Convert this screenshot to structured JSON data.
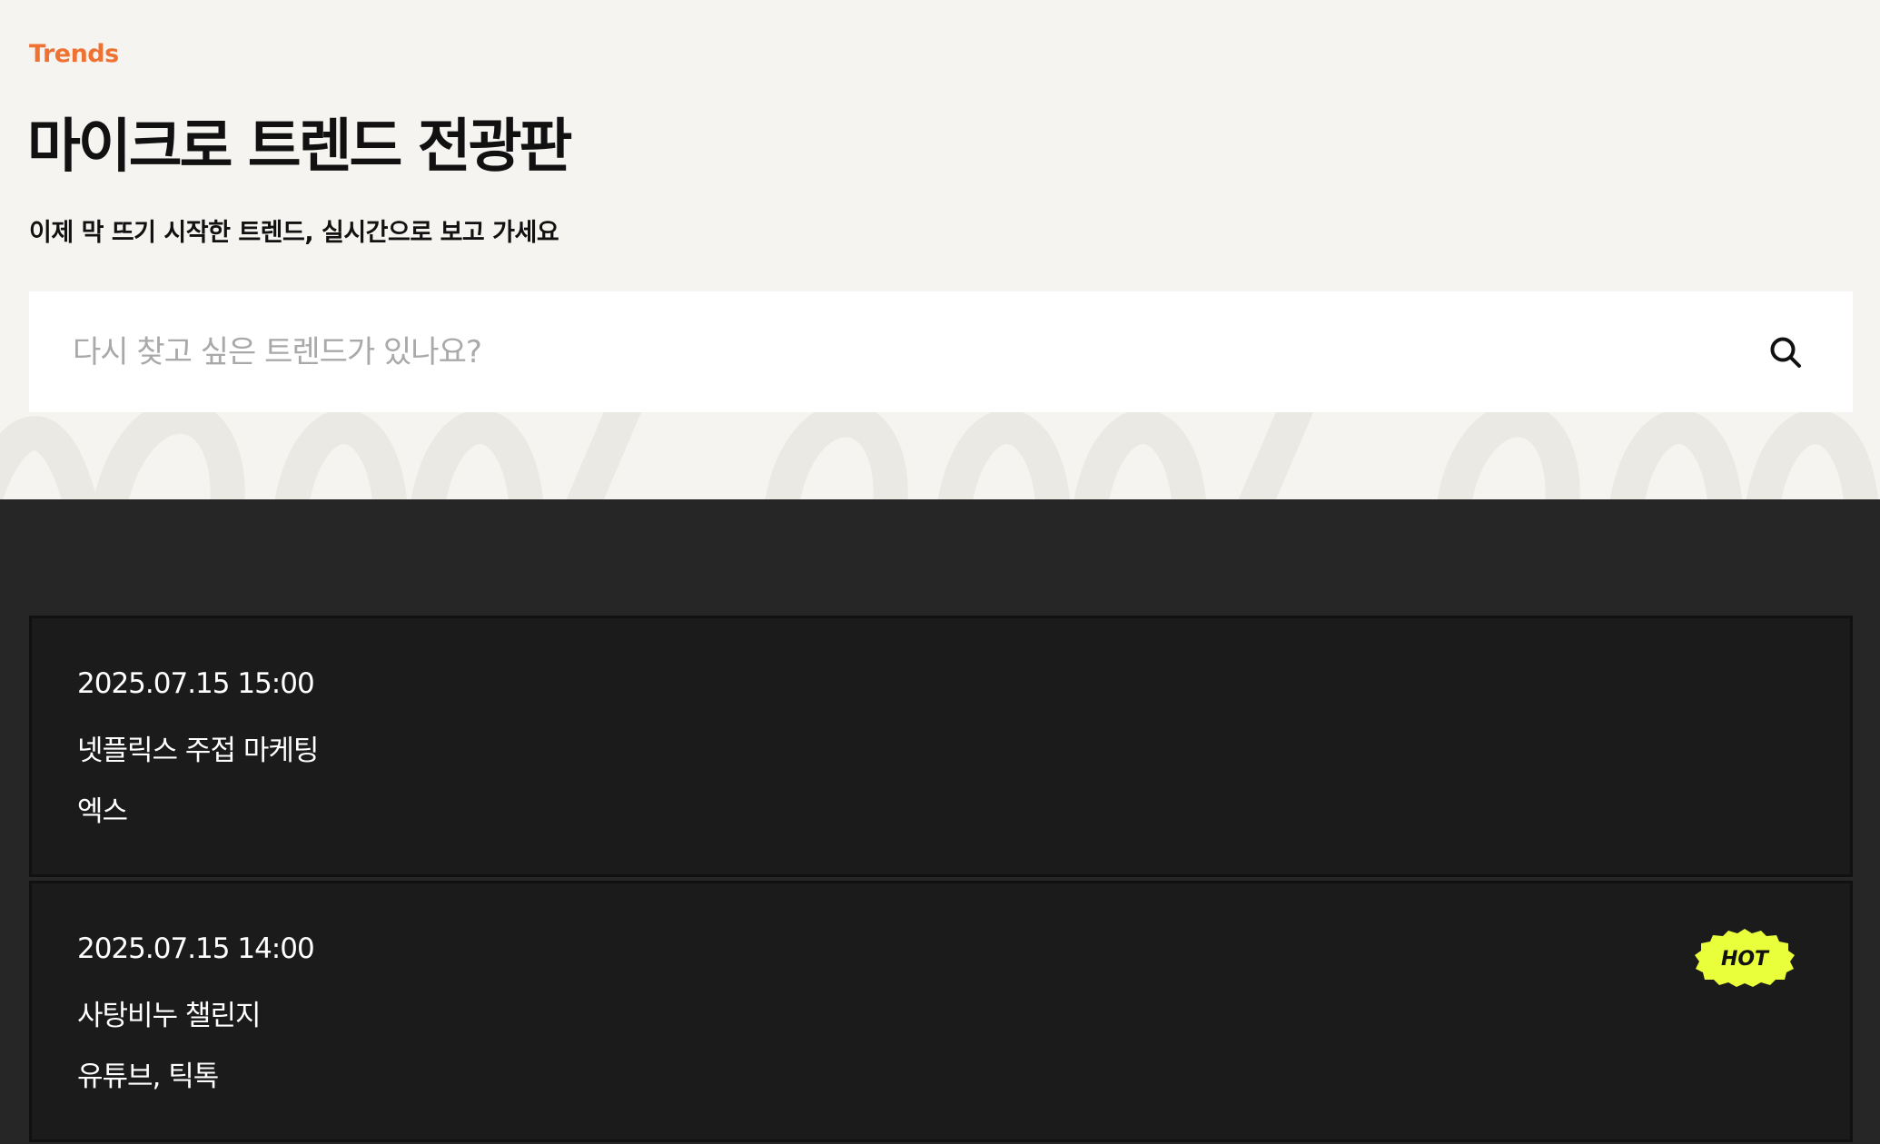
{
  "header": {
    "eyebrow": "Trends",
    "title": "마이크로 트렌드 전광판",
    "subtitle": "이제 막 뜨기 시작한 트렌드, 실시간으로 보고 가세요"
  },
  "search": {
    "placeholder": "다시 찾고 싶은 트렌드가 있나요?",
    "icon": "search-icon"
  },
  "trends": [
    {
      "datetime": "2025.07.15 15:00",
      "title": "넷플릭스 주접 마케팅",
      "platform": "엑스",
      "hot": false
    },
    {
      "datetime": "2025.07.15 14:00",
      "title": "사탕비누 챌린지",
      "platform": "유튜브, 틱톡",
      "hot": true,
      "badge": "HOT"
    }
  ],
  "colors": {
    "accent": "#ef7232",
    "hero_background": "#f5f4f1",
    "list_background": "#262626",
    "card_background": "#1b1b1b",
    "hot_badge": "#e9ff3c"
  }
}
